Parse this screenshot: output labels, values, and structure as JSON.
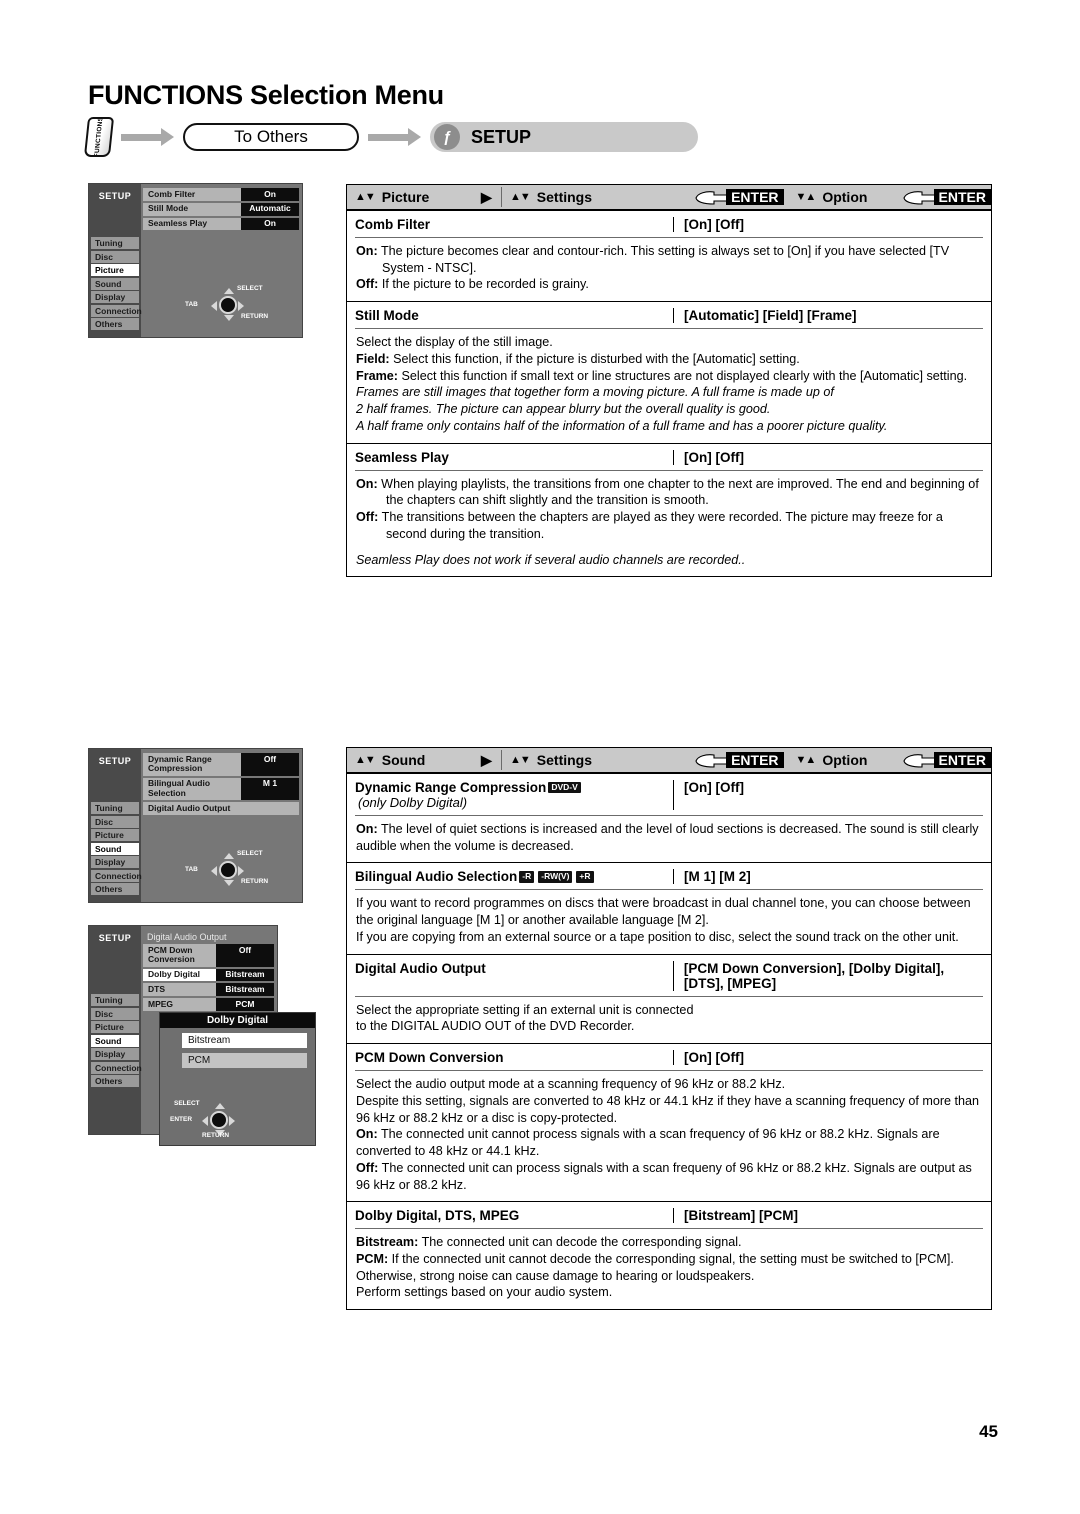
{
  "page": {
    "title": "FUNCTIONS Selection Menu",
    "number": "45"
  },
  "flow": {
    "function_key_label": "FUNCTIONS",
    "step1": "To Others",
    "step2_badge": "ƒ",
    "step2": "SETUP"
  },
  "osd_common": {
    "title": "SETUP",
    "menu": [
      "Tuning",
      "Disc",
      "Picture",
      "Sound",
      "Display",
      "Connection",
      "Others"
    ],
    "pad": {
      "tab": "TAB",
      "select": "SELECT",
      "return": "RETURN",
      "enter": "ENTER"
    }
  },
  "osd_picture": {
    "selected": "Picture",
    "rows": [
      {
        "name": "Comb Filter",
        "value": "On"
      },
      {
        "name": "Still Mode",
        "value": "Automatic"
      },
      {
        "name": "Seamless Play",
        "value": "On"
      }
    ]
  },
  "osd_sound": {
    "selected": "Sound",
    "rows": [
      {
        "name": "Dynamic Range Compression",
        "value": "Off"
      },
      {
        "name": "Bilingual Audio Selection",
        "value": "M 1"
      },
      {
        "name": "Digital Audio Output",
        "value": ""
      }
    ]
  },
  "osd_dao": {
    "selected": "Sound",
    "heading": "Digital Audio Output",
    "rows": [
      {
        "name": "PCM Down Conversion",
        "value": "Off"
      },
      {
        "name": "Dolby Digital",
        "value": "Bitstream"
      },
      {
        "name": "DTS",
        "value": "Bitstream"
      },
      {
        "name": "MPEG",
        "value": "PCM"
      }
    ],
    "popup": {
      "title": "Dolby Digital",
      "options": [
        "Bitstream",
        "PCM"
      ]
    }
  },
  "table_picture": {
    "header": {
      "col1_updown": "▲▼",
      "col1": "Picture",
      "col1_right": "▶",
      "col2_updown": "▲▼",
      "col2": "Settings",
      "enter1": "ENTER",
      "col3_updown": "▼▲",
      "col3": "Option",
      "enter2": "ENTER"
    },
    "rows": [
      {
        "label": "Comb Filter",
        "options": "[On] [Off]",
        "desc": [
          {
            "bold": "On:",
            "text": " The picture becomes clear and contour-rich. This setting is always set to [On] if you have selected [TV System - NTSC].",
            "style": "hang"
          },
          {
            "bold": "Off:",
            "text": " If the picture to be recorded is grainy.",
            "style": "hang"
          }
        ]
      },
      {
        "label": "Still Mode",
        "options": "[Automatic] [Field]  [Frame]",
        "desc": [
          {
            "bold": "",
            "text": "Select the display of the still image.",
            "style": ""
          },
          {
            "bold": "Field:",
            "text": " Select this function, if the picture is disturbed with the [Automatic] setting.",
            "style": "hang"
          },
          {
            "bold": "Frame:",
            "text": " Select this function if small text or line structures are not displayed clearly with the [Automatic] setting.",
            "style": "hang"
          },
          {
            "bold": "",
            "text": "Frames are still images that together form a moving picture. A full frame is made up of",
            "style": "italic"
          },
          {
            "bold": "",
            "text": "2 half frames. The picture can appear blurry but the overall quality is good.",
            "style": "italic"
          },
          {
            "bold": "",
            "text": "A half frame only contains half of the information of a full frame and has a poorer picture quality.",
            "style": "italic"
          }
        ]
      },
      {
        "label": "Seamless Play",
        "options": "[On] [Off]",
        "desc": [
          {
            "bold": "On:",
            "text": "  When playing playlists, the transitions from one chapter to the next are improved. The end and beginning of the chapters can shift slightly and the transition is smooth.",
            "style": "hang2"
          },
          {
            "bold": "Off:",
            "text": " The transitions between the chapters are played as they were recorded. The picture may freeze for a second during the transition.",
            "style": "hang2"
          },
          {
            "bold": "",
            "text": "",
            "style": "gap"
          },
          {
            "bold": "",
            "text": "Seamless Play does not work if several audio channels are recorded..",
            "style": "italic"
          }
        ]
      }
    ]
  },
  "table_sound": {
    "header": {
      "col1_updown": "▲▼",
      "col1": "Sound",
      "col1_right": "▶",
      "col2_updown": "▲▼",
      "col2": "Settings",
      "enter1": "ENTER",
      "col3_updown": "▼▲",
      "col3": "Option",
      "enter2": "ENTER"
    },
    "rows": [
      {
        "label": "Dynamic Range Compression",
        "tags": [
          "DVD-V"
        ],
        "note": "(only Dolby Digital)",
        "options": "[On] [Off]",
        "desc": [
          {
            "bold": "On:",
            "text": " The level of quiet sections is increased and the level of loud sections is decreased. The sound is still clearly audible when the volume is decreased.",
            "style": ""
          }
        ]
      },
      {
        "label": "Bilingual Audio Selection",
        "tags": [
          "-R",
          "-RW(V)",
          "+R"
        ],
        "note": "",
        "options": "[M 1] [M 2]",
        "desc": [
          {
            "bold": "",
            "text": "If you want to record programmes on discs that were broadcast in dual channel tone, you can choose between the original language [M 1] or another available language [M 2].",
            "style": ""
          },
          {
            "bold": "",
            "text": "If you are copying from an external source or a tape position to disc, select the sound track on the other unit.",
            "style": ""
          }
        ]
      },
      {
        "label": "Digital Audio Output",
        "tags": [],
        "note": "",
        "options": "[PCM Down Conversion], [Dolby Digital], [DTS], [MPEG]",
        "desc": [
          {
            "bold": "",
            "text": "Select the appropriate setting if an external unit is connected",
            "style": ""
          },
          {
            "bold": "",
            "text": "to the DIGITAL AUDIO OUT of the DVD Recorder.",
            "style": ""
          }
        ]
      },
      {
        "label": "PCM Down Conversion",
        "tags": [],
        "note": "",
        "options": "[On] [Off]",
        "desc": [
          {
            "bold": "",
            "text": "Select the audio output mode at a scanning frequency of 96 kHz or 88.2 kHz.",
            "style": ""
          },
          {
            "bold": "",
            "text": "Despite this setting, signals are converted to 48 kHz or 44.1 kHz if they have a scanning frequency of more than 96 kHz or 88.2 kHz or a disc is copy-protected.",
            "style": ""
          },
          {
            "bold": "On:",
            "text": " The connected unit cannot process signals with a scan frequency of 96 kHz or 88.2 kHz. Signals are converted to 48 kHz or 44.1 kHz.",
            "style": ""
          },
          {
            "bold": "Off:",
            "text": " The connected unit can process signals with a scan frequeny of 96 kHz or 88.2 kHz. Signals are output as 96 kHz or 88.2 kHz.",
            "style": ""
          }
        ]
      },
      {
        "label": "Dolby Digital, DTS, MPEG",
        "tags": [],
        "note": "",
        "options": "[Bitstream] [PCM]",
        "desc": [
          {
            "bold": "Bitstream:",
            "text": " The connected unit can decode the corresponding signal.",
            "style": ""
          },
          {
            "bold": "PCM:",
            "text": " If the connected unit cannot decode the corresponding signal, the setting must be switched to [PCM]. Otherwise, strong noise can cause damage to hearing or loudspeakers.",
            "style": ""
          },
          {
            "bold": "",
            "text": "Perform settings based on your audio system.",
            "style": ""
          }
        ]
      }
    ]
  }
}
